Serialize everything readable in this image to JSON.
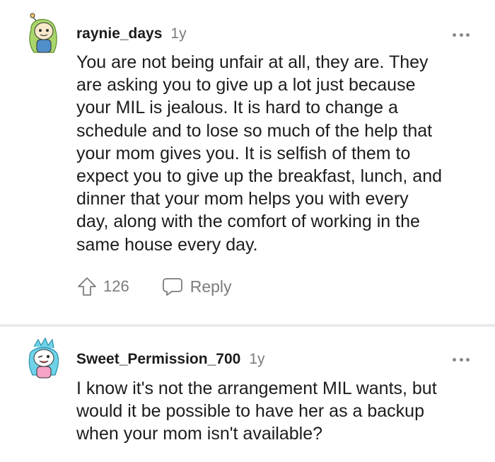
{
  "comments": [
    {
      "username": "raynie_days",
      "age": "1y",
      "body": "You are not being unfair at all, they are. They\nare asking you to give up a lot just because\nyour MIL is jealous. It is hard to change a\nschedule and to lose so much of the help that\nyour mom gives you. It is selfish of them to\nexpect you to give up the breakfast, lunch, and\ndinner that your mom helps you with every\nday, along with the comfort of working in the\nsame house every day.",
      "votes": "126",
      "reply_label": "Reply",
      "icons": {
        "more": "more-options-icon",
        "upvote": "upvote-arrow-icon",
        "reply": "reply-bubble-icon"
      }
    },
    {
      "username": "Sweet_Permission_700",
      "age": "1y",
      "body": "I know it's not the arrangement MIL wants, but\nwould it be possible to have her as a backup\nwhen your mom isn't available?",
      "icons": {
        "more": "more-options-icon"
      }
    }
  ],
  "colors": {
    "text": "#1c1c1c",
    "muted": "#7c7c7c",
    "separator": "#ebebeb",
    "avatar1_hair": "#a8d66a",
    "avatar2_hair": "#6ed3e8"
  }
}
